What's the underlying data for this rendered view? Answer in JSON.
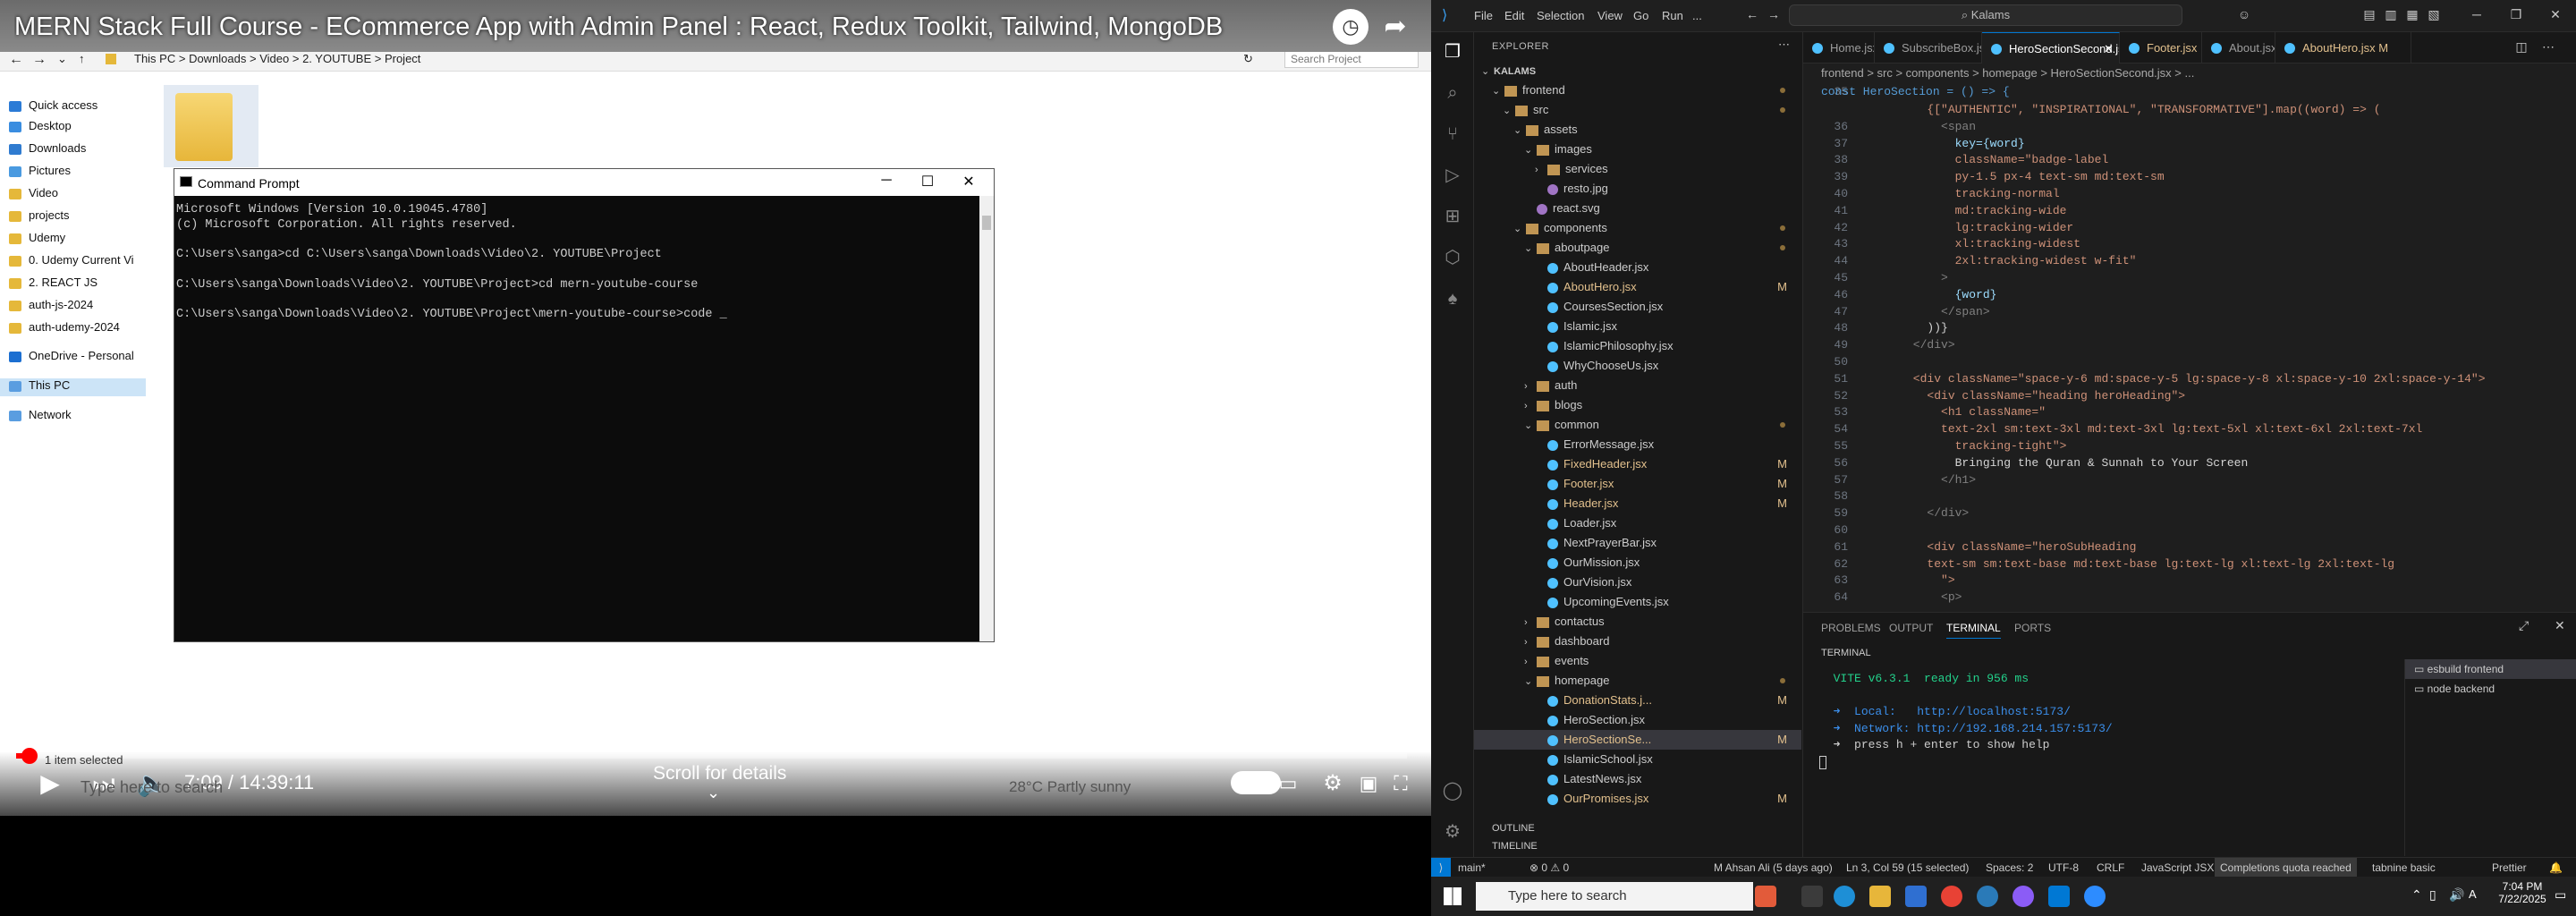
{
  "youtube": {
    "title": "MERN Stack Full Course - ECommerce App with Admin Panel : React, Redux Toolkit, Tailwind, MongoDB",
    "time": "7:09 / 14:39:11",
    "scroll_hint": "Scroll for details",
    "progress_fraction": 0.008
  },
  "file_explorer": {
    "breadcrumb": [
      "This PC",
      "Downloads",
      "Video",
      "2. YOUTUBE",
      "Project"
    ],
    "search_placeholder": "Search Project",
    "sidebar": [
      {
        "label": "Quick access",
        "color": "#2b7bd6"
      },
      {
        "label": "Desktop",
        "color": "#3a8de0"
      },
      {
        "label": "Downloads",
        "color": "#2f7bd0"
      },
      {
        "label": "Pictures",
        "color": "#4a9ae0"
      },
      {
        "label": "Video",
        "color": "#e5b83a"
      },
      {
        "label": "projects",
        "color": "#e5b83a"
      },
      {
        "label": "Udemy",
        "color": "#e5b83a"
      },
      {
        "label": "0. Udemy Current Vi",
        "color": "#e5b83a"
      },
      {
        "label": "2. REACT JS",
        "color": "#e5b83a"
      },
      {
        "label": "auth-js-2024",
        "color": "#e5b83a"
      },
      {
        "label": "auth-udemy-2024",
        "color": "#e5b83a"
      },
      {
        "label": "OneDrive - Personal",
        "color": "#1c6fd1"
      },
      {
        "label": "This PC",
        "color": "#5a9de0"
      },
      {
        "label": "Network",
        "color": "#5a9de0"
      }
    ],
    "status": "1 item selected",
    "ghost_search": "Type here to search",
    "weather": "28°C  Partly sunny"
  },
  "cmd": {
    "title": "Command Prompt",
    "lines": [
      "Microsoft Windows [Version 10.0.19045.4780]",
      "(c) Microsoft Corporation. All rights reserved.",
      "",
      "C:\\Users\\sanga>cd C:\\Users\\sanga\\Downloads\\Video\\2. YOUTUBE\\Project",
      "",
      "C:\\Users\\sanga\\Downloads\\Video\\2. YOUTUBE\\Project>cd mern-youtube-course",
      "",
      "C:\\Users\\sanga\\Downloads\\Video\\2. YOUTUBE\\Project\\mern-youtube-course>code _"
    ]
  },
  "vscode": {
    "menu": [
      "File",
      "Edit",
      "Selection",
      "View",
      "Go",
      "Run",
      "..."
    ],
    "search": "Kalams",
    "explorer_title": "EXPLORER",
    "tree": [
      {
        "label": "KALAMS",
        "depth": 0,
        "type": "root",
        "open": true
      },
      {
        "label": "frontend",
        "depth": 1,
        "type": "folder",
        "open": true,
        "dot": true
      },
      {
        "label": "src",
        "depth": 2,
        "type": "folder",
        "open": true,
        "dot": true
      },
      {
        "label": "assets",
        "depth": 3,
        "type": "folder",
        "open": true
      },
      {
        "label": "images",
        "depth": 4,
        "type": "folder",
        "open": true
      },
      {
        "label": "services",
        "depth": 5,
        "type": "folder",
        "open": false
      },
      {
        "label": "resto.jpg",
        "depth": 5,
        "type": "file"
      },
      {
        "label": "react.svg",
        "depth": 4,
        "type": "file"
      },
      {
        "label": "components",
        "depth": 3,
        "type": "folder",
        "open": true,
        "dot": true
      },
      {
        "label": "aboutpage",
        "depth": 4,
        "type": "folder",
        "open": true,
        "dot": true
      },
      {
        "label": "AboutHeader.jsx",
        "depth": 5,
        "type": "file"
      },
      {
        "label": "AboutHero.jsx",
        "depth": 5,
        "type": "file",
        "mod": "M"
      },
      {
        "label": "CoursesSection.jsx",
        "depth": 5,
        "type": "file"
      },
      {
        "label": "Islamic.jsx",
        "depth": 5,
        "type": "file"
      },
      {
        "label": "IslamicPhilosophy.jsx",
        "depth": 5,
        "type": "file"
      },
      {
        "label": "WhyChooseUs.jsx",
        "depth": 5,
        "type": "file"
      },
      {
        "label": "auth",
        "depth": 4,
        "type": "folder",
        "open": false
      },
      {
        "label": "blogs",
        "depth": 4,
        "type": "folder",
        "open": false
      },
      {
        "label": "common",
        "depth": 4,
        "type": "folder",
        "open": true,
        "dot": true
      },
      {
        "label": "ErrorMessage.jsx",
        "depth": 5,
        "type": "file"
      },
      {
        "label": "FixedHeader.jsx",
        "depth": 5,
        "type": "file",
        "mod": "M"
      },
      {
        "label": "Footer.jsx",
        "depth": 5,
        "type": "file",
        "mod": "M"
      },
      {
        "label": "Header.jsx",
        "depth": 5,
        "type": "file",
        "mod": "M"
      },
      {
        "label": "Loader.jsx",
        "depth": 5,
        "type": "file"
      },
      {
        "label": "NextPrayerBar.jsx",
        "depth": 5,
        "type": "file"
      },
      {
        "label": "OurMission.jsx",
        "depth": 5,
        "type": "file"
      },
      {
        "label": "OurVision.jsx",
        "depth": 5,
        "type": "file"
      },
      {
        "label": "UpcomingEvents.jsx",
        "depth": 5,
        "type": "file"
      },
      {
        "label": "contactus",
        "depth": 4,
        "type": "folder",
        "open": false
      },
      {
        "label": "dashboard",
        "depth": 4,
        "type": "folder",
        "open": false
      },
      {
        "label": "events",
        "depth": 4,
        "type": "folder",
        "open": false
      },
      {
        "label": "homepage",
        "depth": 4,
        "type": "folder",
        "open": true,
        "dot": true
      },
      {
        "label": "DonationStats.j...",
        "depth": 5,
        "type": "file",
        "mod": "M"
      },
      {
        "label": "HeroSection.jsx",
        "depth": 5,
        "type": "file"
      },
      {
        "label": "HeroSectionSe...",
        "depth": 5,
        "type": "file",
        "mod": "M",
        "selected": true
      },
      {
        "label": "IslamicSchool.jsx",
        "depth": 5,
        "type": "file"
      },
      {
        "label": "LatestNews.jsx",
        "depth": 5,
        "type": "file"
      },
      {
        "label": "OurPromises.jsx",
        "depth": 5,
        "type": "file",
        "mod": "M"
      }
    ],
    "tabs": [
      {
        "label": "Home.jsx",
        "active": false,
        "mod": false
      },
      {
        "label": "SubscribeBox.jsx",
        "active": false,
        "mod": false
      },
      {
        "label": "HeroSectionSecond.jsx  M",
        "active": true,
        "mod": true
      },
      {
        "label": "Footer.jsx  M",
        "active": false,
        "mod": true
      },
      {
        "label": "About.jsx",
        "active": false,
        "mod": false
      },
      {
        "label": "AboutHero.jsx  M",
        "active": false,
        "mod": true
      }
    ],
    "breadcrumb": "frontend  >  src  >  components  >  homepage  >  HeroSectionSecond.jsx  >  ...",
    "sticky": {
      "num": "35",
      "text": "const HeroSection = () => {"
    },
    "code": [
      {
        "n": "",
        "t": "        {[\"AUTHENTIC\", \"INSPIRATIONAL\", \"TRANSFORMATIVE\"].map((word) => (",
        "c": "#ce9178"
      },
      {
        "n": "36",
        "t": "          <span",
        "c": "#808080"
      },
      {
        "n": "37",
        "t": "            key={word}",
        "c": "#9cdcfe"
      },
      {
        "n": "38",
        "t": "            className=\"badge-label",
        "c": "#ce9178"
      },
      {
        "n": "39",
        "t": "            py-1.5 px-4 text-sm md:text-sm",
        "c": "#ce9178"
      },
      {
        "n": "40",
        "t": "            tracking-normal",
        "c": "#ce9178"
      },
      {
        "n": "41",
        "t": "            md:tracking-wide",
        "c": "#ce9178"
      },
      {
        "n": "42",
        "t": "            lg:tracking-wider",
        "c": "#ce9178"
      },
      {
        "n": "43",
        "t": "            xl:tracking-widest",
        "c": "#ce9178"
      },
      {
        "n": "44",
        "t": "            2xl:tracking-widest w-fit\"",
        "c": "#ce9178"
      },
      {
        "n": "45",
        "t": "          >",
        "c": "#808080"
      },
      {
        "n": "46",
        "t": "            {word}",
        "c": "#9cdcfe"
      },
      {
        "n": "47",
        "t": "          </span>",
        "c": "#808080"
      },
      {
        "n": "48",
        "t": "        ))}",
        "c": "#d4d4d4"
      },
      {
        "n": "49",
        "t": "      </div>",
        "c": "#808080"
      },
      {
        "n": "50",
        "t": "",
        "c": "#d4d4d4"
      },
      {
        "n": "51",
        "t": "      <div className=\"space-y-6 md:space-y-5 lg:space-y-8 xl:space-y-10 2xl:space-y-14\">",
        "c": "#ce9178"
      },
      {
        "n": "52",
        "t": "        <div className=\"heading heroHeading\">",
        "c": "#ce9178"
      },
      {
        "n": "53",
        "t": "          <h1 className=\"",
        "c": "#ce9178"
      },
      {
        "n": "54",
        "t": "          text-2xl sm:text-3xl md:text-3xl lg:text-5xl xl:text-6xl 2xl:text-7xl",
        "c": "#ce9178"
      },
      {
        "n": "55",
        "t": "            tracking-tight\">",
        "c": "#ce9178"
      },
      {
        "n": "56",
        "t": "            Bringing the Quran & Sunnah to Your Screen",
        "c": "#d4d4d4"
      },
      {
        "n": "57",
        "t": "          </h1>",
        "c": "#808080"
      },
      {
        "n": "58",
        "t": "",
        "c": "#d4d4d4"
      },
      {
        "n": "59",
        "t": "        </div>",
        "c": "#808080"
      },
      {
        "n": "60",
        "t": "",
        "c": "#d4d4d4"
      },
      {
        "n": "61",
        "t": "        <div className=\"heroSubHeading",
        "c": "#ce9178"
      },
      {
        "n": "62",
        "t": "        text-sm sm:text-base md:text-base lg:text-lg xl:text-lg 2xl:text-lg",
        "c": "#ce9178"
      },
      {
        "n": "63",
        "t": "          \">",
        "c": "#ce9178"
      },
      {
        "n": "64",
        "t": "          <p>",
        "c": "#808080"
      }
    ],
    "panel_tabs": [
      "PROBLEMS",
      "OUTPUT",
      "TERMINAL",
      "PORTS"
    ],
    "terminal_title": "TERMINAL",
    "terminal": [
      {
        "t": "  VITE v6.3.1  ready in 956 ms",
        "c": "#23d18b"
      },
      {
        "t": "",
        "c": "#ccc"
      },
      {
        "t": "  ➜  Local:   http://localhost:5173/",
        "c": "#3b8eea"
      },
      {
        "t": "  ➜  Network: http://192.168.214.157:5173/",
        "c": "#3b8eea"
      },
      {
        "t": "  ➜  press h + enter to show help",
        "c": "#ccc"
      }
    ],
    "terminal_list": [
      {
        "label": "esbuild  frontend"
      },
      {
        "label": "node  backend"
      }
    ],
    "outline": "OUTLINE",
    "timeline": "TIMELINE",
    "status": {
      "branch": "main*",
      "errors": "⊗ 0 ⚠ 0",
      "author": "M Ahsan Ali (5 days ago)",
      "cursor": "Ln 3, Col 59 (15 selected)",
      "spaces": "Spaces: 2",
      "encoding": "UTF-8",
      "eol": "CRLF",
      "lang": "JavaScript JSX",
      "quota": "Completions quota reached",
      "tabnine": "tabnine basic",
      "prettier": "Prettier"
    }
  },
  "taskbar": {
    "search": "Type here to search",
    "time": "7:04 PM",
    "date": "7/22/2025"
  }
}
